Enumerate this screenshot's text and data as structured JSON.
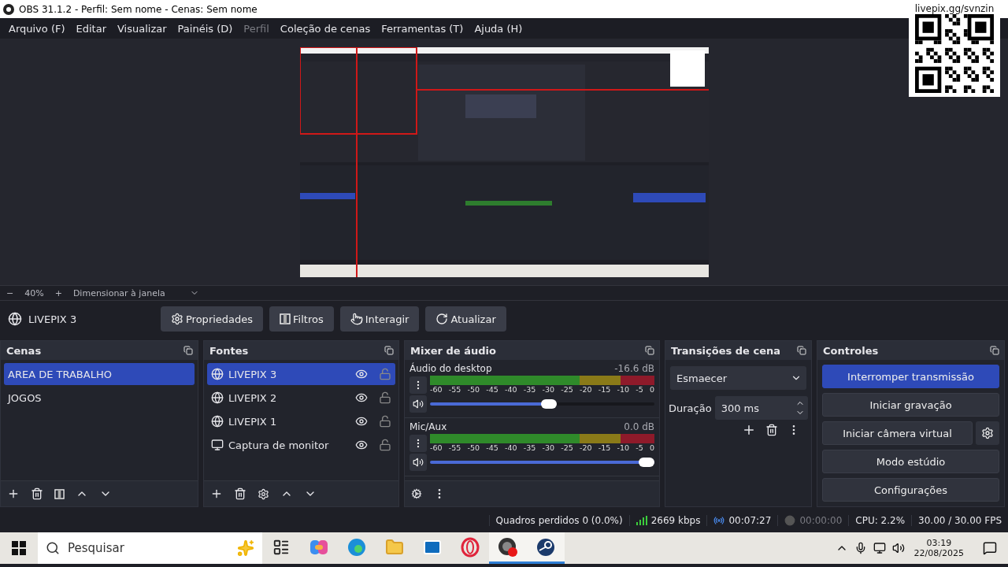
{
  "window": {
    "title": "OBS 31.1.2 - Perfil: Sem nome - Cenas: Sem nome"
  },
  "menu": [
    {
      "label": "Arquivo (F)",
      "disabled": false
    },
    {
      "label": "Editar",
      "disabled": false
    },
    {
      "label": "Visualizar",
      "disabled": false
    },
    {
      "label": "Painéis (D)",
      "disabled": false
    },
    {
      "label": "Perfil",
      "disabled": true
    },
    {
      "label": "Coleção de cenas",
      "disabled": false
    },
    {
      "label": "Ferramentas (T)",
      "disabled": false
    },
    {
      "label": "Ajuda (H)",
      "disabled": false
    }
  ],
  "overlay": {
    "url": "livepix.gg/svnzin"
  },
  "zoom_bar": {
    "minus": "−",
    "zoom": "40%",
    "plus": "+",
    "mode": "Dimensionar à janela"
  },
  "source_toolbar": {
    "source": "LIVEPIX 3",
    "buttons": [
      {
        "label": "Propriedades",
        "kind": "properties"
      },
      {
        "label": "Filtros",
        "kind": "filters"
      },
      {
        "label": "Interagir",
        "kind": "interact"
      },
      {
        "label": "Atualizar",
        "kind": "refresh"
      }
    ]
  },
  "scenes": {
    "title": "Cenas",
    "items": [
      {
        "label": "AREA DE TRABALHO",
        "selected": true
      },
      {
        "label": "JOGOS",
        "selected": false
      }
    ]
  },
  "sources": {
    "title": "Fontes",
    "items": [
      {
        "label": "LIVEPIX 3",
        "kind": "browser",
        "selected": true,
        "visible": true,
        "locked": false
      },
      {
        "label": "LIVEPIX 2",
        "kind": "browser",
        "selected": false,
        "visible": true,
        "locked": false
      },
      {
        "label": "LIVEPIX 1",
        "kind": "browser",
        "selected": false,
        "visible": true,
        "locked": false
      },
      {
        "label": "Captura de monitor",
        "kind": "monitor",
        "selected": false,
        "visible": true,
        "locked": false
      }
    ]
  },
  "mixer": {
    "title": "Mixer de áudio",
    "channels": [
      {
        "name": "Áudio do desktop",
        "reading": "-16.6 dB",
        "level": 0.53,
        "scale": [
          "-60",
          "-55",
          "-50",
          "-45",
          "-40",
          "-35",
          "-30",
          "-25",
          "-20",
          "-15",
          "-10",
          "-5",
          "0"
        ]
      },
      {
        "name": "Mic/Aux",
        "reading": "0.0 dB",
        "level": 1,
        "scale": [
          "-60",
          "-55",
          "-50",
          "-45",
          "-40",
          "-35",
          "-30",
          "-25",
          "-20",
          "-15",
          "-10",
          "-5",
          "0"
        ]
      }
    ]
  },
  "transitions": {
    "title": "Transições de cena",
    "selected": "Esmaecer",
    "duration_label": "Duração",
    "duration": "300 ms"
  },
  "controls": {
    "title": "Controles",
    "buttons": [
      {
        "label": "Interromper transmissão",
        "active": true,
        "kind": "plain"
      },
      {
        "label": "Iniciar gravação",
        "active": false,
        "kind": "plain"
      },
      {
        "label": "Iniciar câmera virtual",
        "active": false,
        "kind": "with-settings"
      },
      {
        "label": "Modo estúdio",
        "active": false,
        "kind": "plain"
      },
      {
        "label": "Configurações",
        "active": false,
        "kind": "plain"
      }
    ]
  },
  "status_bar": {
    "dropped": "Quadros perdidos 0 (0.0%)",
    "bitrate": "2669 kbps",
    "stream_time": "00:07:27",
    "record_time": "00:00:00",
    "cpu": "CPU: 2.2%",
    "fps": "30.00 / 30.00 FPS"
  },
  "taskbar": {
    "search_placeholder": "Pesquisar",
    "apps": [
      {
        "kind": "taskview",
        "active": false
      },
      {
        "kind": "copilot",
        "active": false
      },
      {
        "kind": "edge",
        "active": false
      },
      {
        "kind": "explorer",
        "active": false
      },
      {
        "kind": "outlook",
        "active": false
      },
      {
        "kind": "opera",
        "active": false
      },
      {
        "kind": "obs",
        "active": true
      },
      {
        "kind": "steam",
        "active": true
      }
    ],
    "time": "03:19",
    "date": "22/08/2025"
  }
}
